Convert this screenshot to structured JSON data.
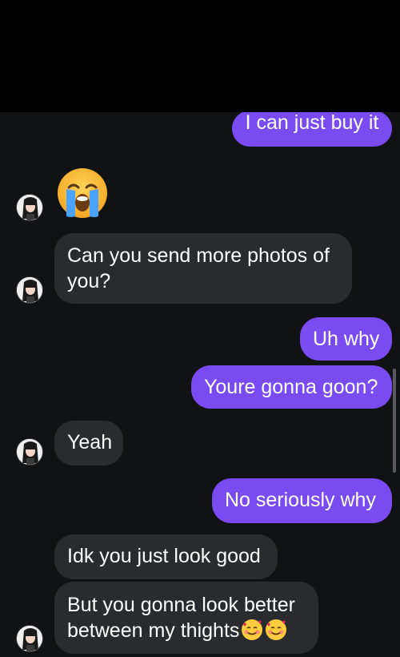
{
  "messages": [
    {
      "id": "m1",
      "direction": "sent",
      "text": "I can just buy it"
    },
    {
      "id": "m2",
      "direction": "received",
      "emoji": "loudly-crying-face-emoji"
    },
    {
      "id": "m3",
      "direction": "received",
      "text": "Can you send more photos of you?"
    },
    {
      "id": "m4",
      "direction": "sent",
      "text": "Uh why"
    },
    {
      "id": "m5",
      "direction": "sent",
      "text": "Youre gonna goon?"
    },
    {
      "id": "m6",
      "direction": "received",
      "text": "Yeah"
    },
    {
      "id": "m7",
      "direction": "sent",
      "text": "No seriously why"
    },
    {
      "id": "m8",
      "direction": "received",
      "text": "Idk you just look good"
    },
    {
      "id": "m9",
      "direction": "received",
      "text": "But you gonna look better between my thights"
    }
  ],
  "colors": {
    "sent_bubble": "#7b4bf2",
    "received_bubble": "#2a2b2f",
    "background": "#111214",
    "header": "#000000"
  },
  "icons": {
    "avatar": "contact-avatar-icon",
    "emoji_inline": "smiling-face-with-hearts-emoji"
  }
}
